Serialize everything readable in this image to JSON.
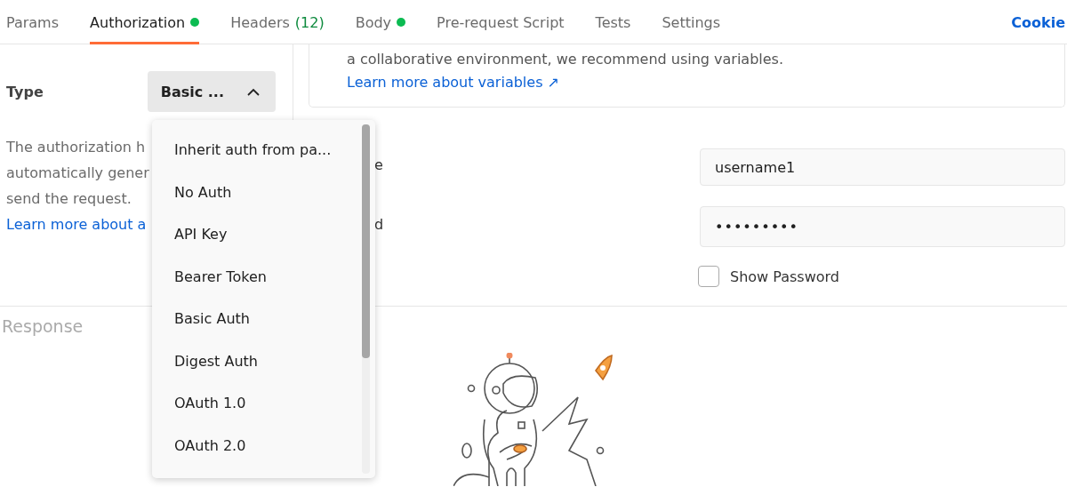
{
  "tabs": [
    {
      "label": "Params",
      "selected": false,
      "dot": false
    },
    {
      "label": "Authorization",
      "selected": true,
      "dot": true
    },
    {
      "label": "Headers",
      "count": "(12)",
      "selected": false,
      "dot": false
    },
    {
      "label": "Body",
      "selected": false,
      "dot": true
    },
    {
      "label": "Pre-request Script",
      "selected": false,
      "dot": false
    },
    {
      "label": "Tests",
      "selected": false,
      "dot": false
    },
    {
      "label": "Settings",
      "selected": false,
      "dot": false
    }
  ],
  "cookies_link": "Cookie",
  "auth": {
    "type_label": "Type",
    "type_value": "Basic ...",
    "expanded": true,
    "description_lines": [
      "The authorization h",
      "automatically gener",
      "send the request."
    ],
    "learn_more": "Learn more about a"
  },
  "dropdown": {
    "items": [
      {
        "label": "Inherit auth from pa...",
        "selected": false
      },
      {
        "label": "No Auth",
        "selected": false
      },
      {
        "label": "API Key",
        "selected": false
      },
      {
        "label": "Bearer Token",
        "selected": false
      },
      {
        "label": "Basic Auth",
        "selected": false
      },
      {
        "label": "Digest Auth",
        "selected": false
      },
      {
        "label": "OAuth 1.0",
        "selected": false
      },
      {
        "label": "OAuth 2.0",
        "selected": false
      }
    ]
  },
  "notice": {
    "text": "a collaborative environment, we recommend using variables.",
    "link": "Learn more about variables ↗"
  },
  "fields": [
    {
      "label": "e",
      "value": "username1",
      "kind": "text"
    },
    {
      "label": "d",
      "value": "•••••••••",
      "kind": "password"
    }
  ],
  "show_password": {
    "label": "Show Password",
    "checked": false
  },
  "response": {
    "title": "Response"
  }
}
